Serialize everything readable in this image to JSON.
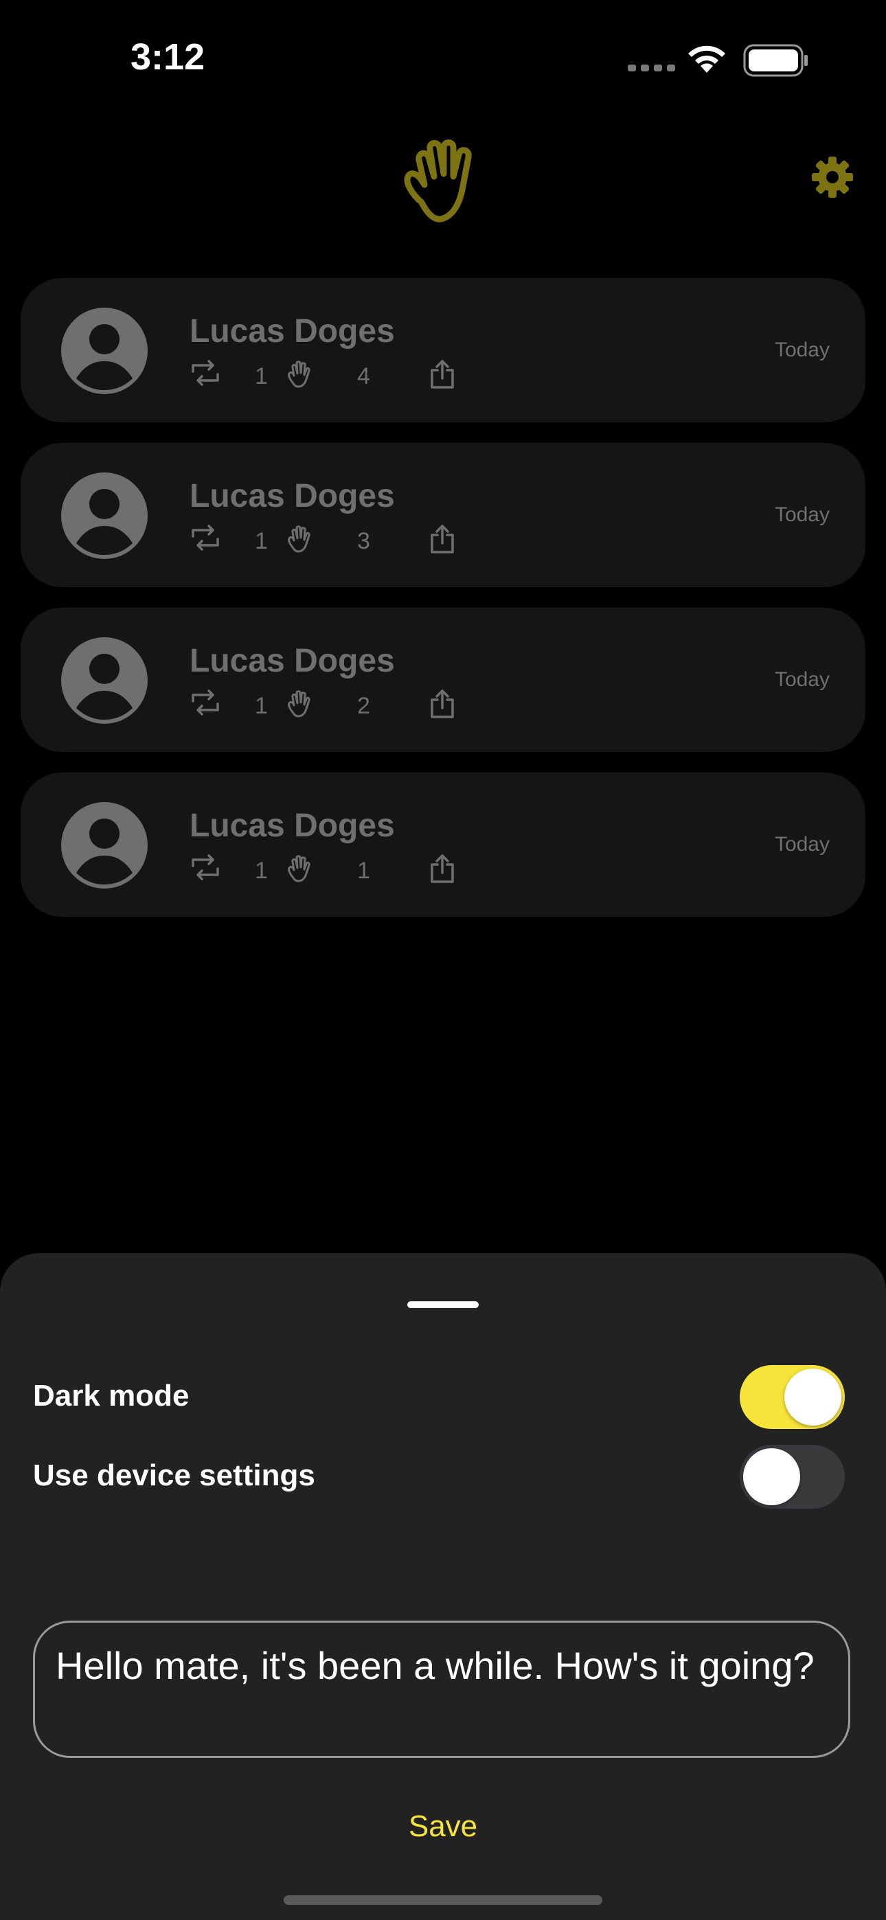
{
  "status_bar": {
    "time": "3:12"
  },
  "header": {
    "logo_icon": "wave-hand-icon",
    "settings_icon": "gear-icon",
    "accent": "#7d7313"
  },
  "cards": [
    {
      "name": "Lucas Doges",
      "reposts": "1",
      "waves": "4",
      "date": "Today"
    },
    {
      "name": "Lucas Doges",
      "reposts": "1",
      "waves": "3",
      "date": "Today"
    },
    {
      "name": "Lucas Doges",
      "reposts": "1",
      "waves": "2",
      "date": "Today"
    },
    {
      "name": "Lucas Doges",
      "reposts": "1",
      "waves": "1",
      "date": "Today"
    }
  ],
  "sheet": {
    "dark_mode_label": "Dark mode",
    "dark_mode_on": true,
    "device_settings_label": "Use device settings",
    "device_settings_on": false,
    "message": "Hello mate, it's been a while. How's it going?",
    "save_label": "Save",
    "accent": "#f7e43a"
  }
}
